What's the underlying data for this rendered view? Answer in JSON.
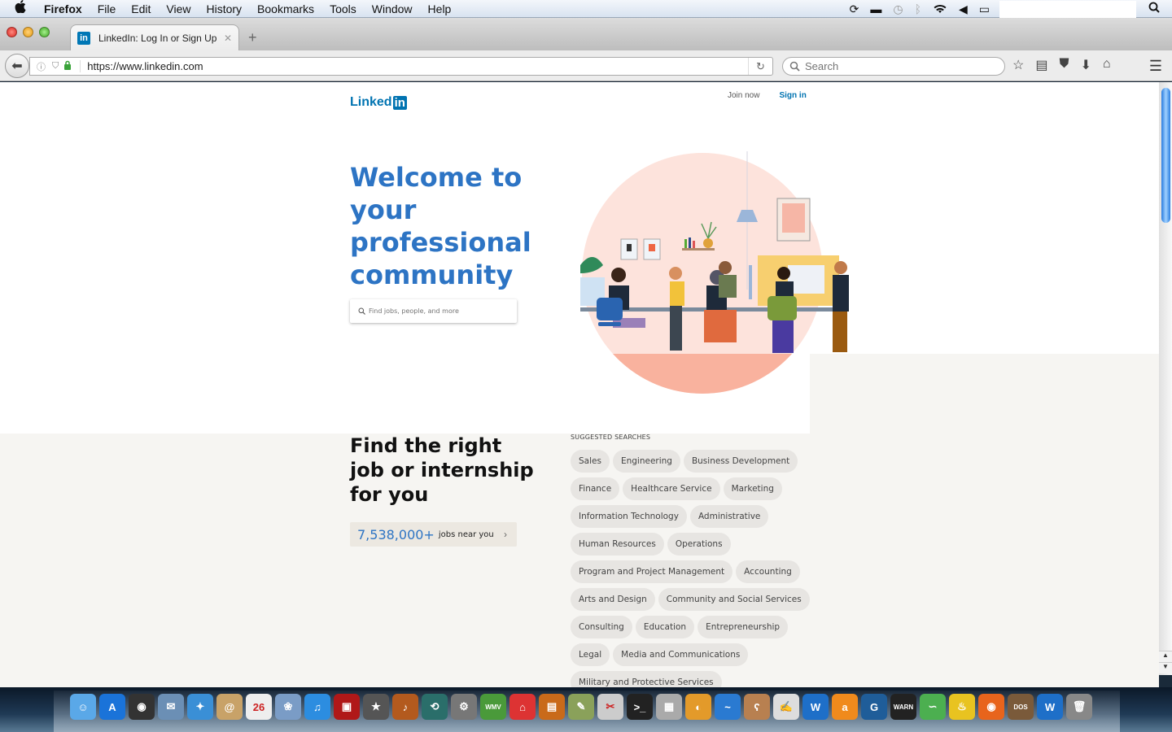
{
  "menubar": {
    "apple": "",
    "app": "Firefox",
    "items": [
      "File",
      "Edit",
      "View",
      "History",
      "Bookmarks",
      "Tools",
      "Window",
      "Help"
    ],
    "tray": [
      "sync-icon",
      "display-icon",
      "time-machine-icon",
      "bluetooth-icon",
      "wifi-icon",
      "volume-icon",
      "battery-icon"
    ],
    "spotlight": "🔍"
  },
  "browser": {
    "tab": {
      "title": "LinkedIn: Log In or Sign Up",
      "favicon": "in",
      "close": "✕"
    },
    "new_tab": "+",
    "url": "https://www.linkedin.com",
    "search_placeholder": "Search"
  },
  "page": {
    "logo": {
      "text": "Linked",
      "badge": "in"
    },
    "nav": {
      "join": "Join now",
      "sign_in": "Sign in"
    },
    "headline": "Welcome to your professional community",
    "search_placeholder": "Find jobs, people, and more",
    "jobs": {
      "headline": "Find the right job or internship for you",
      "count": "7,538,000+",
      "label": "jobs near you",
      "chevron": "›"
    },
    "suggested": {
      "label": "SUGGESTED SEARCHES",
      "items": [
        "Sales",
        "Engineering",
        "Business Development",
        "Finance",
        "Healthcare Service",
        "Marketing",
        "Information Technology",
        "Administrative",
        "Human Resources",
        "Operations",
        "Program and Project Management",
        "Accounting",
        "Arts and Design",
        "Community and Social Services",
        "Consulting",
        "Education",
        "Entrepreneurship",
        "Legal",
        "Media and Communications",
        "Military and Protective Services"
      ]
    }
  },
  "colors": {
    "brand": "#0073b1",
    "headline": "#2d74c4",
    "pill_bg": "#e7e5e2"
  },
  "dock": {
    "apps": [
      {
        "name": "finder",
        "label": "☺",
        "bg": "#5aa8e8"
      },
      {
        "name": "app-store",
        "label": "A",
        "bg": "#1a73d9"
      },
      {
        "name": "dashboard",
        "label": "◉",
        "bg": "#333"
      },
      {
        "name": "mail",
        "label": "✉",
        "bg": "#6b8fb5"
      },
      {
        "name": "safari",
        "label": "✦",
        "bg": "#3a8fd6"
      },
      {
        "name": "contacts",
        "label": "@",
        "bg": "#c8a268"
      },
      {
        "name": "calendar",
        "label": "26",
        "bg": "#eee"
      },
      {
        "name": "iphoto",
        "label": "❀",
        "bg": "#7a9cc6"
      },
      {
        "name": "itunes",
        "label": "♫",
        "bg": "#2c8de0"
      },
      {
        "name": "photo-booth",
        "label": "▣",
        "bg": "#b01818"
      },
      {
        "name": "imovie",
        "label": "★",
        "bg": "#555"
      },
      {
        "name": "garageband",
        "label": "♪",
        "bg": "#b35a1e"
      },
      {
        "name": "time-machine",
        "label": "⟲",
        "bg": "#2a6e6a"
      },
      {
        "name": "system-prefs",
        "label": "⚙",
        "bg": "#777"
      },
      {
        "name": "wmv-player",
        "label": "WMV",
        "bg": "#4a9a3a"
      },
      {
        "name": "home-app",
        "label": "⌂",
        "bg": "#d33"
      },
      {
        "name": "image-capture",
        "label": "▤",
        "bg": "#c96a1a"
      },
      {
        "name": "cleaner",
        "label": "✎",
        "bg": "#8aa15a"
      },
      {
        "name": "grab",
        "label": "✂",
        "bg": "#ccc"
      },
      {
        "name": "terminal",
        "label": ">_",
        "bg": "#222"
      },
      {
        "name": "calculator",
        "label": "▦",
        "bg": "#aaa"
      },
      {
        "name": "grapher",
        "label": "◐",
        "bg": "#e39a2a"
      },
      {
        "name": "openoffice",
        "label": "~",
        "bg": "#2a7ad1"
      },
      {
        "name": "growl-bear",
        "label": "ʕ",
        "bg": "#b88050"
      },
      {
        "name": "textedit",
        "label": "✍",
        "bg": "#ddd"
      },
      {
        "name": "wineskin",
        "label": "W",
        "bg": "#1e6fc8"
      },
      {
        "name": "amazon-music",
        "label": "a",
        "bg": "#f08a1c"
      },
      {
        "name": "home-network",
        "label": "G",
        "bg": "#1f5d99"
      },
      {
        "name": "console",
        "label": "WARN",
        "bg": "#222"
      },
      {
        "name": "genie",
        "label": "∽",
        "bg": "#4caf50"
      },
      {
        "name": "cyberduck",
        "label": "♨",
        "bg": "#e8c320"
      },
      {
        "name": "firefox",
        "label": "◉",
        "bg": "#e8641c"
      },
      {
        "name": "dosbox",
        "label": "DOS",
        "bg": "#7a5a3a"
      },
      {
        "name": "wineskin-2",
        "label": "W",
        "bg": "#1e6fc8"
      },
      {
        "name": "trash",
        "label": "🗑",
        "bg": "#888"
      }
    ]
  }
}
